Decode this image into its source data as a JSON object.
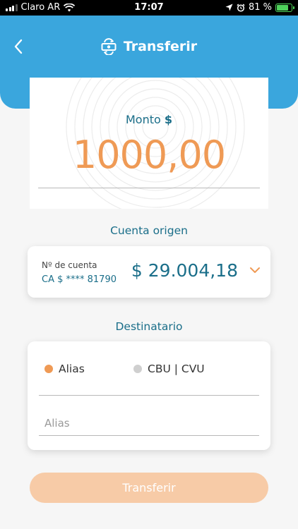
{
  "status_bar": {
    "carrier": "Claro AR",
    "time": "17:07",
    "battery_text": "81 %",
    "battery_level": 0.81
  },
  "header": {
    "title": "Transferir",
    "back_icon": "chevron-left-icon",
    "title_icon": "money-transfer-icon"
  },
  "amount": {
    "label": "Monto",
    "currency": "$",
    "value": "1000,00"
  },
  "origin": {
    "section_label": "Cuenta origen",
    "account_label": "Nº de cuenta",
    "account_number": "CA $ **** 81790",
    "balance": "$ 29.004,18"
  },
  "destination": {
    "section_label": "Destinatario",
    "options": [
      "Alias",
      "CBU | CVU"
    ],
    "selected": "Alias",
    "input_placeholder": "Alias",
    "input_value": ""
  },
  "action": {
    "button_label": "Transferir"
  },
  "colors": {
    "header_bg": "#3aa6dd",
    "primary_text": "#1a6e89",
    "accent": "#ef9a55",
    "button_disabled": "#f7cba7"
  }
}
